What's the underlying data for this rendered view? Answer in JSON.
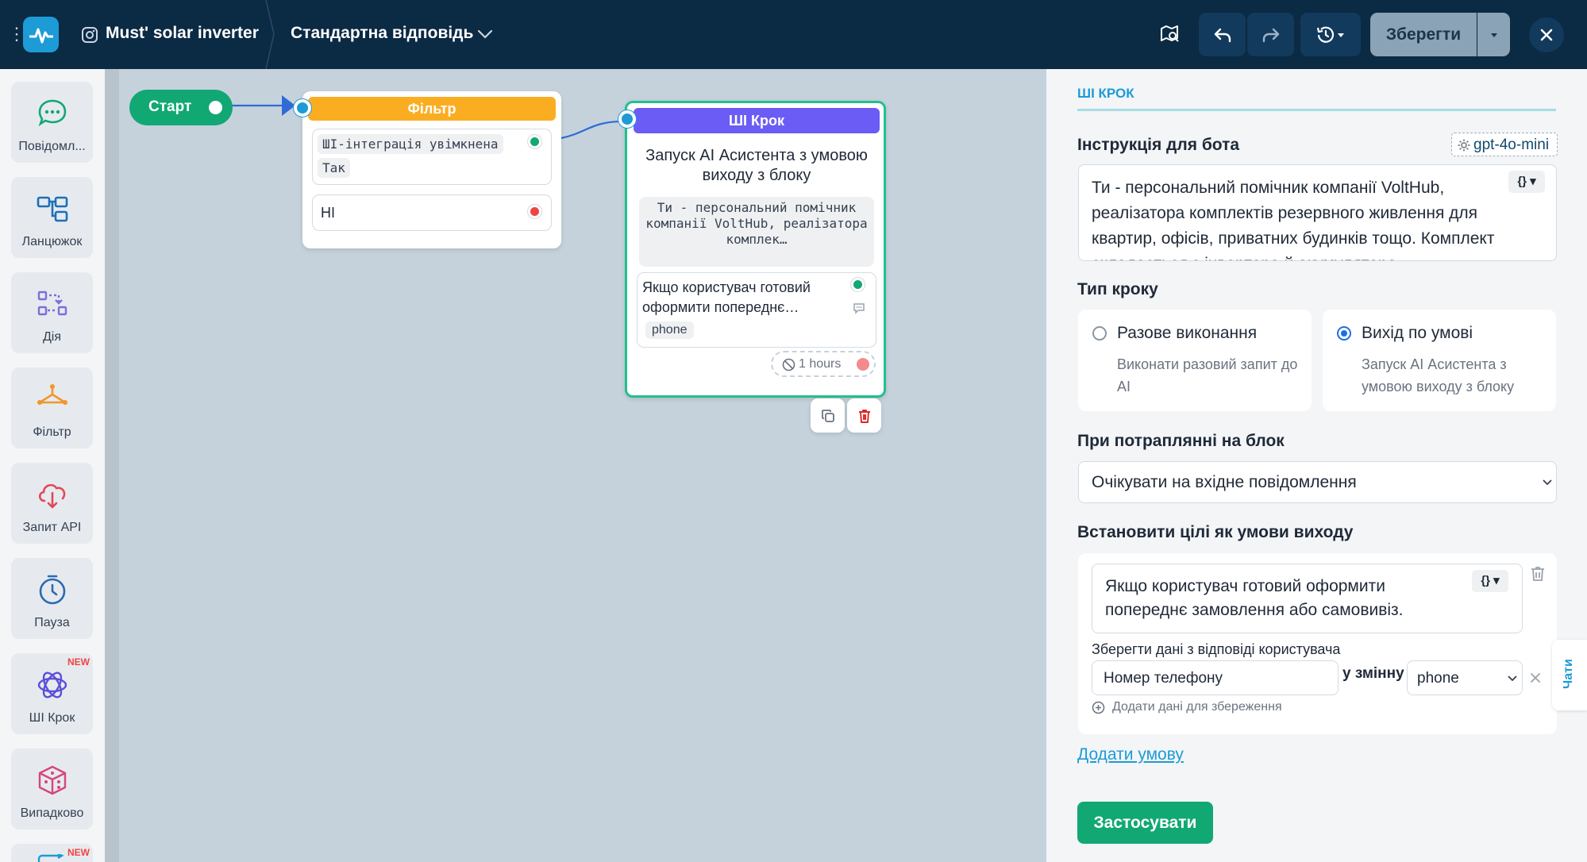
{
  "header": {
    "bot_name": "Must' solar inverter",
    "flow_name": "Стандартна відповідь",
    "save_label": "Зберегти"
  },
  "sidebar": {
    "items": [
      {
        "label": "Повідомл...",
        "icon": "message-icon"
      },
      {
        "label": "Ланцюжок",
        "icon": "chain-icon"
      },
      {
        "label": "Дія",
        "icon": "action-icon"
      },
      {
        "label": "Фільтр",
        "icon": "filter-icon"
      },
      {
        "label": "Запит API",
        "icon": "api-cloud-icon"
      },
      {
        "label": "Пауза",
        "icon": "clock-icon"
      },
      {
        "label": "ШІ Крок",
        "icon": "ai-step-icon",
        "badge": "NEW"
      },
      {
        "label": "Випадково",
        "icon": "dice-icon"
      }
    ],
    "extra_badge": "NEW"
  },
  "canvas": {
    "start_label": "Старт",
    "filter_node": {
      "title": "Фільтр",
      "condition_chip": "ШІ-інтеграція увімкнена",
      "value_chip": "Так",
      "else_label": "НІ"
    },
    "ai_node": {
      "title": "ШІ Крок",
      "description": "Запуск AI Асистента з умовою виходу з блоку",
      "prompt_preview": "Ти - персональний помічник компанії VoltHub, реалізатора комплек…",
      "condition_text": "Якщо користувач готовий оформити попереднє…",
      "condition_variable": "phone",
      "timeout_label": "1 hours"
    }
  },
  "panel": {
    "section_title": "ШІ КРОК",
    "instruction_label": "Інструкція для бота",
    "model_name": "gpt-4o-mini",
    "instruction_text": "Ти - персональний помічник компанії VoltHub, реалізатора комплектів резервного живлення для квартир, офісів, приватних будинків тощо. Комплект складається з інвертора й акумулятора",
    "step_type_label": "Тип кроку",
    "step_types": [
      {
        "title": "Разове виконання",
        "desc": "Виконати разовий запит до AI",
        "selected": false
      },
      {
        "title": "Вихід по умові",
        "desc": "Запуск AI Асистента з умовою виходу з блоку",
        "selected": true
      }
    ],
    "on_enter_label": "При потраплянні на блок",
    "on_enter_value": "Очікувати на вхідне повідомлення",
    "goals_label": "Встановити цілі як умови виходу",
    "goal_text": "Якщо користувач готовий оформити попереднє замовлення або самовивіз.",
    "save_data_label": "Зберегти дані з відповіді користувача",
    "save_data_value": "Номер телефону",
    "to_variable_label": "у змінну",
    "variable_value": "phone",
    "add_data_label": "Додати дані для збереження",
    "add_condition_label": "Додати умову",
    "apply_label": "Застосувати",
    "chats_tab": "Чати"
  },
  "colors": {
    "topbar": "#0b2a44",
    "accent": "#1d9bd6",
    "green": "#11a874",
    "filter": "#fbad22",
    "ai_header": "#6b5cf5"
  }
}
